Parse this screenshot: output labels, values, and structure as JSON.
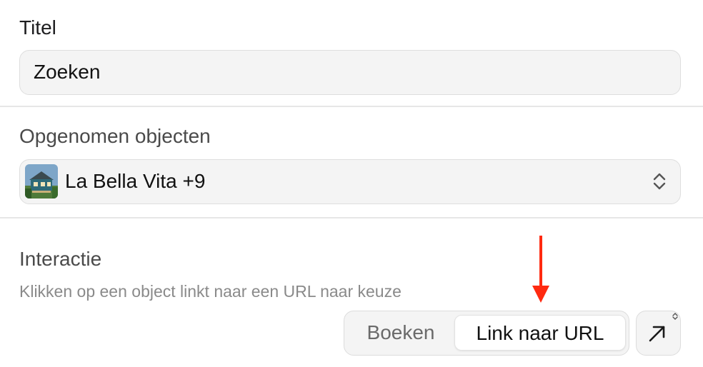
{
  "title_section": {
    "label": "Titel",
    "input_value": "Zoeken"
  },
  "objects_section": {
    "label": "Opgenomen objecten",
    "selected_value": "La Bella Vita +9"
  },
  "interaction_section": {
    "label": "Interactie",
    "description": "Klikken op een object linkt naar een URL naar keuze",
    "options": [
      "Boeken",
      "Link naar URL"
    ],
    "selected_option": "Link naar URL"
  },
  "icons": {
    "select_chevrons": "chevron-up-down-icon",
    "external_link": "arrow-up-right-icon",
    "annotation": "red-down-arrow"
  },
  "colors": {
    "annotation_red": "#ff2a10",
    "field_bg": "#f4f4f4"
  }
}
